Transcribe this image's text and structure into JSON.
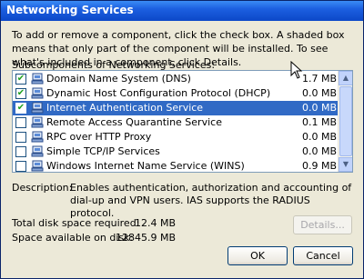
{
  "window": {
    "title": "Networking Services"
  },
  "intro_text": "To add or remove a component, click the check box. A shaded box means that only part of the component will be installed. To see what's included in a component, click Details.",
  "subcomponents_label": "Subcomponents of Networking Services:",
  "components": [
    {
      "name": "Domain Name System (DNS)",
      "size": "1.7 MB",
      "checked": true,
      "selected": false
    },
    {
      "name": "Dynamic Host Configuration Protocol (DHCP)",
      "size": "0.0 MB",
      "checked": true,
      "selected": false
    },
    {
      "name": "Internet Authentication Service",
      "size": "0.0 MB",
      "checked": true,
      "selected": true
    },
    {
      "name": "Remote Access Quarantine Service",
      "size": "0.1 MB",
      "checked": false,
      "selected": false
    },
    {
      "name": "RPC over HTTP Proxy",
      "size": "0.0 MB",
      "checked": false,
      "selected": false
    },
    {
      "name": "Simple TCP/IP Services",
      "size": "0.0 MB",
      "checked": false,
      "selected": false
    },
    {
      "name": "Windows Internet Name Service (WINS)",
      "size": "0.9 MB",
      "checked": false,
      "selected": false
    }
  ],
  "description": {
    "label": "Description:",
    "text": "Enables authentication, authorization and accounting of dial-up and VPN users. IAS supports the RADIUS protocol."
  },
  "disk": {
    "required_label": "Total disk space required:",
    "required_value": "12.4 MB",
    "available_label": "Space available on disk:",
    "available_value": "12845.9 MB"
  },
  "buttons": {
    "details": "Details...",
    "ok": "OK",
    "cancel": "Cancel"
  },
  "colors": {
    "titlebar": "#0c48c8",
    "selection": "#316ac5",
    "dialog_bg": "#ece9d8"
  }
}
